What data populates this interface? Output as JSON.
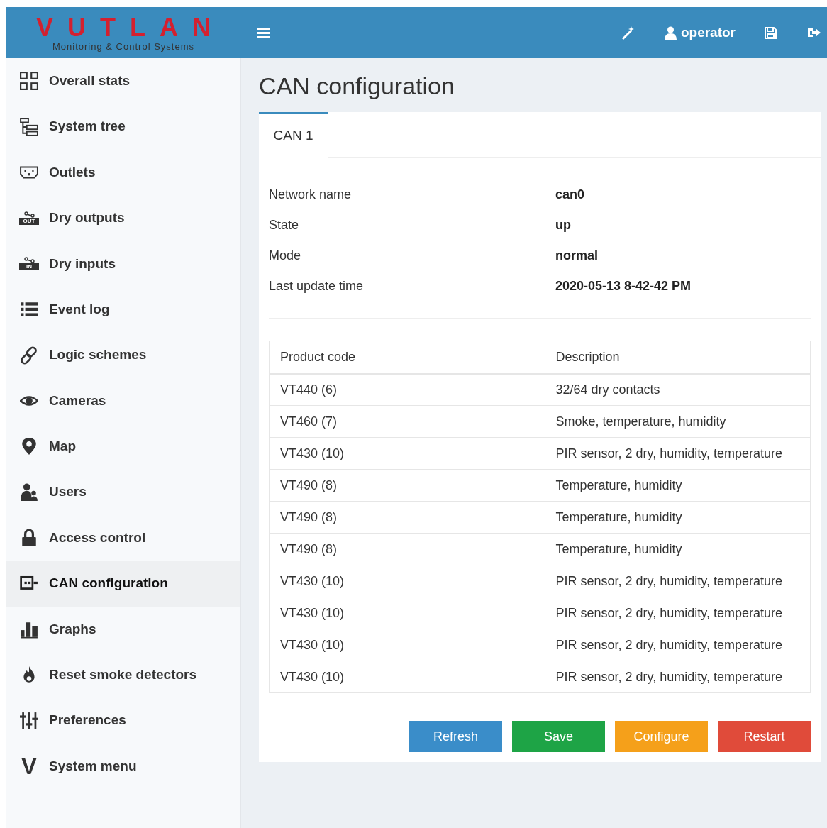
{
  "header": {
    "logo": "VUTLAN",
    "tagline": "Monitoring & Control Systems",
    "user": "operator"
  },
  "sidebar": {
    "items": [
      {
        "label": "Overall stats",
        "selected": false
      },
      {
        "label": "System tree",
        "selected": false
      },
      {
        "label": "Outlets",
        "selected": false
      },
      {
        "label": "Dry outputs",
        "selected": false,
        "badge": "OUT"
      },
      {
        "label": "Dry inputs",
        "selected": false,
        "badge": "IN"
      },
      {
        "label": "Event log",
        "selected": false
      },
      {
        "label": "Logic schemes",
        "selected": false
      },
      {
        "label": "Cameras",
        "selected": false
      },
      {
        "label": "Map",
        "selected": false
      },
      {
        "label": "Users",
        "selected": false
      },
      {
        "label": "Access control",
        "selected": false
      },
      {
        "label": "CAN configuration",
        "selected": true
      },
      {
        "label": "Graphs",
        "selected": false
      },
      {
        "label": "Reset smoke detectors",
        "selected": false
      },
      {
        "label": "Preferences",
        "selected": false
      },
      {
        "label": "System menu",
        "selected": false,
        "glyph": "V"
      }
    ]
  },
  "page": {
    "title": "CAN configuration",
    "tabs": [
      {
        "label": "CAN 1",
        "selected": true
      }
    ],
    "info": [
      {
        "label": "Network name",
        "value": "can0"
      },
      {
        "label": "State",
        "value": "up"
      },
      {
        "label": "Mode",
        "value": "normal"
      },
      {
        "label": "Last update time",
        "value": "2020-05-13 8-42-42 PM"
      }
    ],
    "table": {
      "columns": [
        "Product code",
        "Description"
      ],
      "rows": [
        [
          "VT440 (6)",
          "32/64 dry contacts"
        ],
        [
          "VT460 (7)",
          "Smoke, temperature, humidity"
        ],
        [
          "VT430 (10)",
          "PIR sensor, 2 dry, humidity, temperature"
        ],
        [
          "VT490 (8)",
          "Temperature, humidity"
        ],
        [
          "VT490 (8)",
          "Temperature, humidity"
        ],
        [
          "VT490 (8)",
          "Temperature, humidity"
        ],
        [
          "VT430 (10)",
          "PIR sensor, 2 dry, humidity, temperature"
        ],
        [
          "VT430 (10)",
          "PIR sensor, 2 dry, humidity, temperature"
        ],
        [
          "VT430 (10)",
          "PIR sensor, 2 dry, humidity, temperature"
        ],
        [
          "VT430 (10)",
          "PIR sensor, 2 dry, humidity, temperature"
        ]
      ]
    },
    "buttons": [
      {
        "label": "Refresh",
        "color": "#3a8dc9"
      },
      {
        "label": "Save",
        "color": "#1ea446"
      },
      {
        "label": "Configure",
        "color": "#f5a01a"
      },
      {
        "label": "Restart",
        "color": "#e04b3a"
      }
    ]
  }
}
